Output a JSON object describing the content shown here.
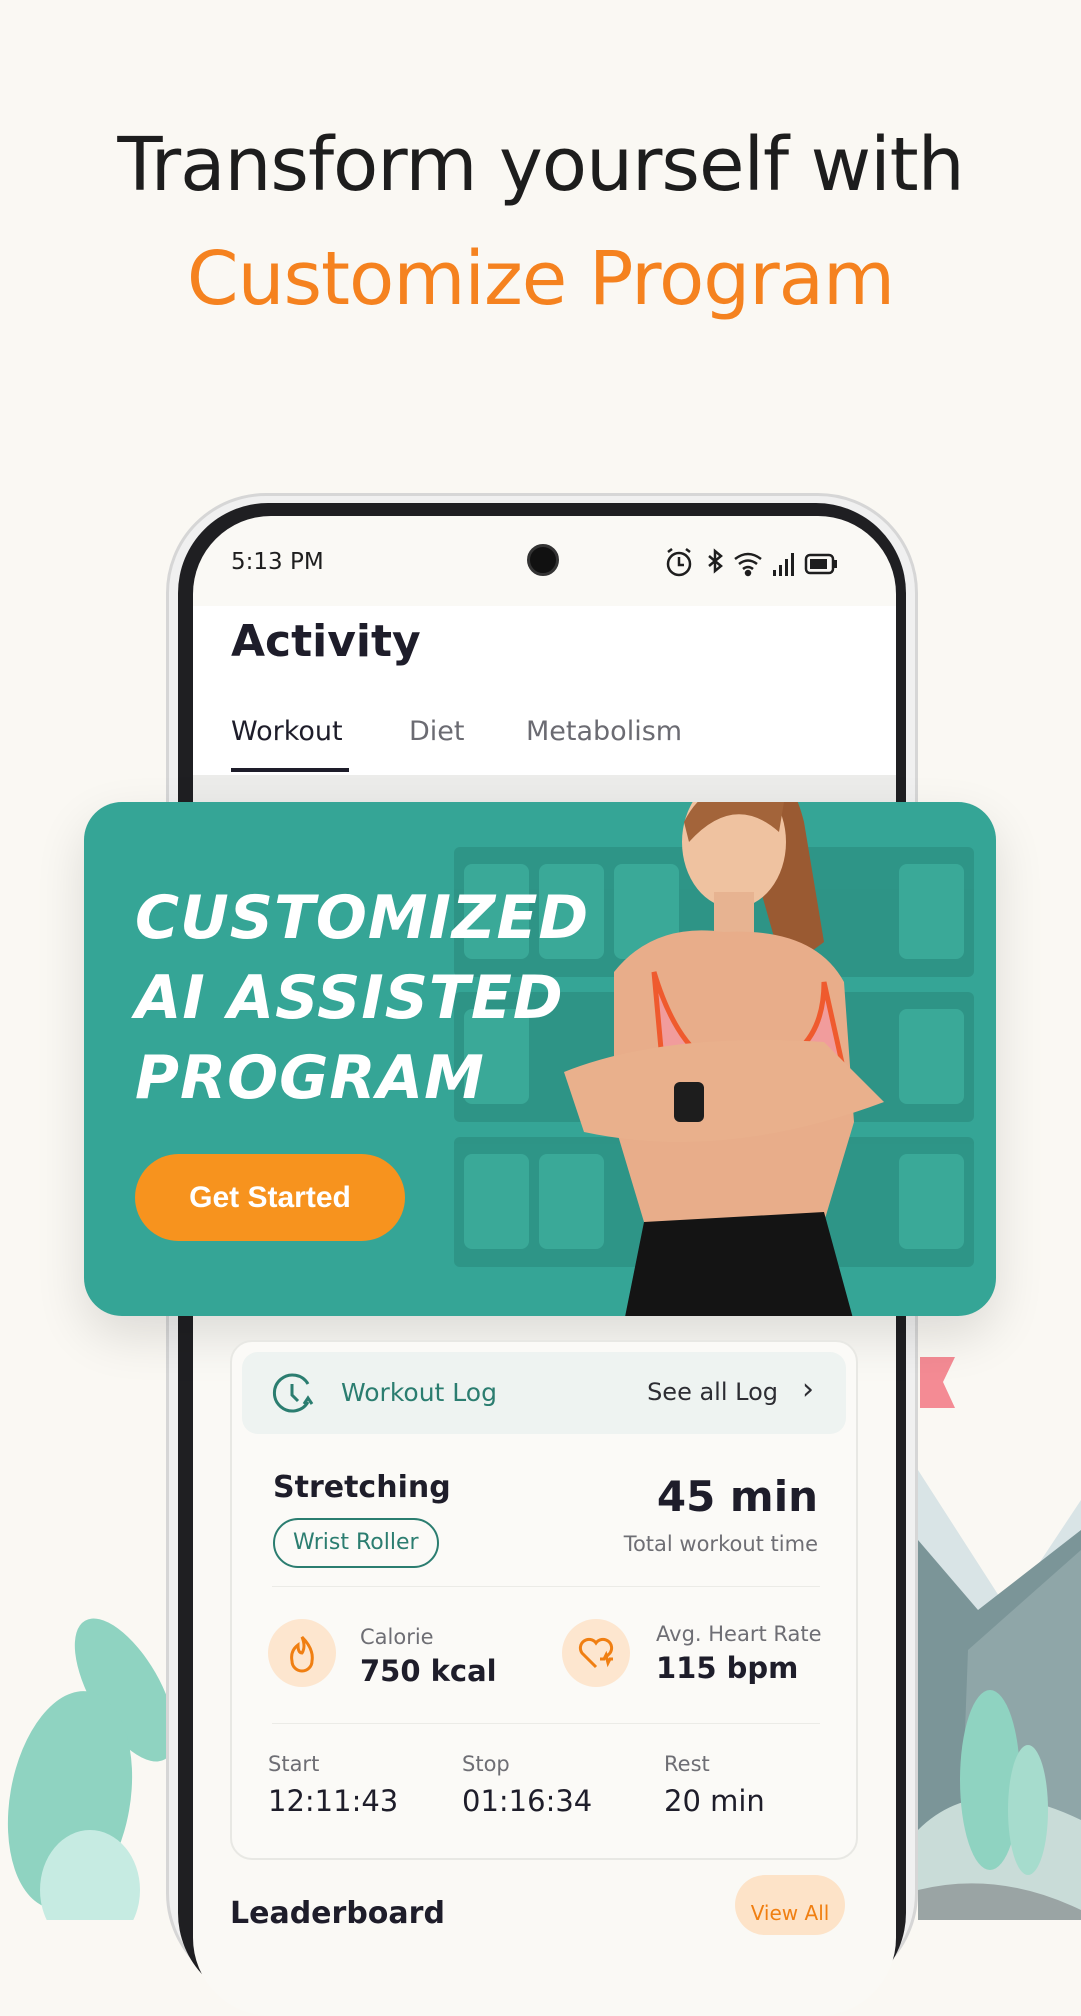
{
  "headline": {
    "line1": "Transform yourself with",
    "line2": "Customize Program"
  },
  "status_bar": {
    "time": "5:13 PM",
    "icons": [
      "alarm-icon",
      "bluetooth-icon",
      "wifi-icon",
      "signal-icon",
      "battery-icon"
    ]
  },
  "page": {
    "title": "Activity"
  },
  "tabs": [
    {
      "label": "Workout",
      "active": true
    },
    {
      "label": "Diet"
    },
    {
      "label": "Metabolism"
    }
  ],
  "banner": {
    "lines": [
      "CUSTOMIZED",
      "AI ASSISTED",
      "PROGRAM"
    ],
    "cta": "Get Started"
  },
  "workout_log": {
    "title": "Workout Log",
    "see_all": "See all Log",
    "exercise": "Stretching",
    "tag": "Wrist Roller",
    "total_time": "45 min",
    "total_label": "Total workout time",
    "calorie_label": "Calorie",
    "calorie_value": "750 kcal",
    "heart_label": "Avg. Heart Rate",
    "heart_value": "115 bpm",
    "start_label": "Start",
    "start_value": "12:11:43",
    "stop_label": "Stop",
    "stop_value": "01:16:34",
    "rest_label": "Rest",
    "rest_value": "20 min"
  },
  "leaderboard": {
    "title": "Leaderboard",
    "view_all": "View All"
  },
  "colors": {
    "teal": "#35a596",
    "orange": "#f7931e",
    "headline_orange": "#f5821f",
    "text": "#1e1d2a"
  }
}
